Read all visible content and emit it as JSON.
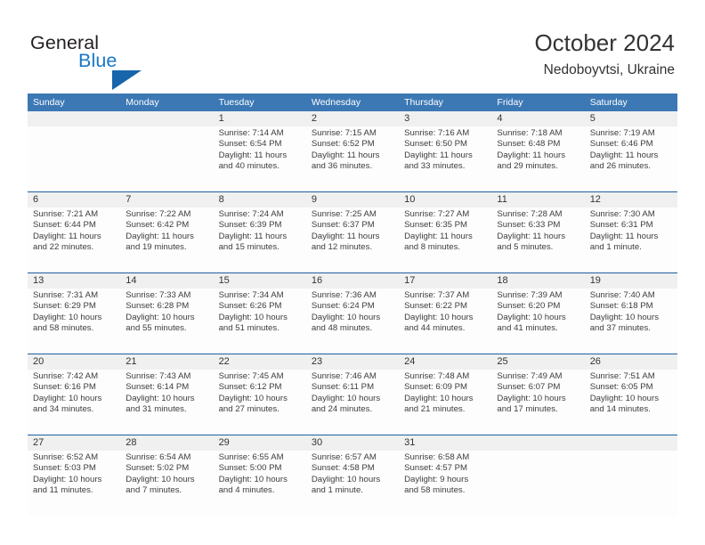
{
  "logo": {
    "word_primary": "General",
    "word_secondary": "Blue",
    "triangle_icon": "triangle-icon",
    "primary_color": "#231f20",
    "secondary_color": "#1878c8",
    "triangle_color": "#1765ab"
  },
  "header": {
    "title": "October 2024",
    "subtitle": "Nedoboyvtsi, Ukraine"
  },
  "theme": {
    "header_band": "#3c78b4",
    "row_divider": "#1f5fa0",
    "date_band": "#f0f0f0",
    "cell_bg": "#fdfdfd",
    "text": "#333333"
  },
  "day_names": [
    "Sunday",
    "Monday",
    "Tuesday",
    "Wednesday",
    "Thursday",
    "Friday",
    "Saturday"
  ],
  "weeks": [
    [
      {
        "day": "",
        "lines": []
      },
      {
        "day": "",
        "lines": []
      },
      {
        "day": "1",
        "lines": [
          "Sunrise: 7:14 AM",
          "Sunset: 6:54 PM",
          "Daylight: 11 hours",
          "and 40 minutes."
        ]
      },
      {
        "day": "2",
        "lines": [
          "Sunrise: 7:15 AM",
          "Sunset: 6:52 PM",
          "Daylight: 11 hours",
          "and 36 minutes."
        ]
      },
      {
        "day": "3",
        "lines": [
          "Sunrise: 7:16 AM",
          "Sunset: 6:50 PM",
          "Daylight: 11 hours",
          "and 33 minutes."
        ]
      },
      {
        "day": "4",
        "lines": [
          "Sunrise: 7:18 AM",
          "Sunset: 6:48 PM",
          "Daylight: 11 hours",
          "and 29 minutes."
        ]
      },
      {
        "day": "5",
        "lines": [
          "Sunrise: 7:19 AM",
          "Sunset: 6:46 PM",
          "Daylight: 11 hours",
          "and 26 minutes."
        ]
      }
    ],
    [
      {
        "day": "6",
        "lines": [
          "Sunrise: 7:21 AM",
          "Sunset: 6:44 PM",
          "Daylight: 11 hours",
          "and 22 minutes."
        ]
      },
      {
        "day": "7",
        "lines": [
          "Sunrise: 7:22 AM",
          "Sunset: 6:42 PM",
          "Daylight: 11 hours",
          "and 19 minutes."
        ]
      },
      {
        "day": "8",
        "lines": [
          "Sunrise: 7:24 AM",
          "Sunset: 6:39 PM",
          "Daylight: 11 hours",
          "and 15 minutes."
        ]
      },
      {
        "day": "9",
        "lines": [
          "Sunrise: 7:25 AM",
          "Sunset: 6:37 PM",
          "Daylight: 11 hours",
          "and 12 minutes."
        ]
      },
      {
        "day": "10",
        "lines": [
          "Sunrise: 7:27 AM",
          "Sunset: 6:35 PM",
          "Daylight: 11 hours",
          "and 8 minutes."
        ]
      },
      {
        "day": "11",
        "lines": [
          "Sunrise: 7:28 AM",
          "Sunset: 6:33 PM",
          "Daylight: 11 hours",
          "and 5 minutes."
        ]
      },
      {
        "day": "12",
        "lines": [
          "Sunrise: 7:30 AM",
          "Sunset: 6:31 PM",
          "Daylight: 11 hours",
          "and 1 minute."
        ]
      }
    ],
    [
      {
        "day": "13",
        "lines": [
          "Sunrise: 7:31 AM",
          "Sunset: 6:29 PM",
          "Daylight: 10 hours",
          "and 58 minutes."
        ]
      },
      {
        "day": "14",
        "lines": [
          "Sunrise: 7:33 AM",
          "Sunset: 6:28 PM",
          "Daylight: 10 hours",
          "and 55 minutes."
        ]
      },
      {
        "day": "15",
        "lines": [
          "Sunrise: 7:34 AM",
          "Sunset: 6:26 PM",
          "Daylight: 10 hours",
          "and 51 minutes."
        ]
      },
      {
        "day": "16",
        "lines": [
          "Sunrise: 7:36 AM",
          "Sunset: 6:24 PM",
          "Daylight: 10 hours",
          "and 48 minutes."
        ]
      },
      {
        "day": "17",
        "lines": [
          "Sunrise: 7:37 AM",
          "Sunset: 6:22 PM",
          "Daylight: 10 hours",
          "and 44 minutes."
        ]
      },
      {
        "day": "18",
        "lines": [
          "Sunrise: 7:39 AM",
          "Sunset: 6:20 PM",
          "Daylight: 10 hours",
          "and 41 minutes."
        ]
      },
      {
        "day": "19",
        "lines": [
          "Sunrise: 7:40 AM",
          "Sunset: 6:18 PM",
          "Daylight: 10 hours",
          "and 37 minutes."
        ]
      }
    ],
    [
      {
        "day": "20",
        "lines": [
          "Sunrise: 7:42 AM",
          "Sunset: 6:16 PM",
          "Daylight: 10 hours",
          "and 34 minutes."
        ]
      },
      {
        "day": "21",
        "lines": [
          "Sunrise: 7:43 AM",
          "Sunset: 6:14 PM",
          "Daylight: 10 hours",
          "and 31 minutes."
        ]
      },
      {
        "day": "22",
        "lines": [
          "Sunrise: 7:45 AM",
          "Sunset: 6:12 PM",
          "Daylight: 10 hours",
          "and 27 minutes."
        ]
      },
      {
        "day": "23",
        "lines": [
          "Sunrise: 7:46 AM",
          "Sunset: 6:11 PM",
          "Daylight: 10 hours",
          "and 24 minutes."
        ]
      },
      {
        "day": "24",
        "lines": [
          "Sunrise: 7:48 AM",
          "Sunset: 6:09 PM",
          "Daylight: 10 hours",
          "and 21 minutes."
        ]
      },
      {
        "day": "25",
        "lines": [
          "Sunrise: 7:49 AM",
          "Sunset: 6:07 PM",
          "Daylight: 10 hours",
          "and 17 minutes."
        ]
      },
      {
        "day": "26",
        "lines": [
          "Sunrise: 7:51 AM",
          "Sunset: 6:05 PM",
          "Daylight: 10 hours",
          "and 14 minutes."
        ]
      }
    ],
    [
      {
        "day": "27",
        "lines": [
          "Sunrise: 6:52 AM",
          "Sunset: 5:03 PM",
          "Daylight: 10 hours",
          "and 11 minutes."
        ]
      },
      {
        "day": "28",
        "lines": [
          "Sunrise: 6:54 AM",
          "Sunset: 5:02 PM",
          "Daylight: 10 hours",
          "and 7 minutes."
        ]
      },
      {
        "day": "29",
        "lines": [
          "Sunrise: 6:55 AM",
          "Sunset: 5:00 PM",
          "Daylight: 10 hours",
          "and 4 minutes."
        ]
      },
      {
        "day": "30",
        "lines": [
          "Sunrise: 6:57 AM",
          "Sunset: 4:58 PM",
          "Daylight: 10 hours",
          "and 1 minute."
        ]
      },
      {
        "day": "31",
        "lines": [
          "Sunrise: 6:58 AM",
          "Sunset: 4:57 PM",
          "Daylight: 9 hours",
          "and 58 minutes."
        ]
      },
      {
        "day": "",
        "lines": []
      },
      {
        "day": "",
        "lines": []
      }
    ]
  ]
}
